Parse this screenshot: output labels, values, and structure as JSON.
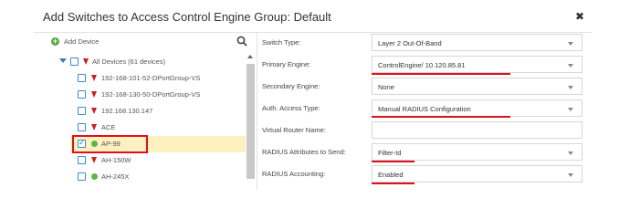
{
  "dialog": {
    "title": "Add Switches to Access Control Engine Group: Default",
    "close_icon": "close-icon"
  },
  "tree": {
    "add_label": "Add Device",
    "root_label": "All Devices (61 devices)",
    "nodes": [
      {
        "label": "192-168-101-52-DPortGroup-VS",
        "status": "down",
        "checked": false
      },
      {
        "label": "192-168-130-50-DPortGroup-VS",
        "status": "down",
        "checked": false
      },
      {
        "label": "192.168.130.147",
        "status": "down",
        "checked": false
      },
      {
        "label": "ACE",
        "status": "down",
        "checked": false
      },
      {
        "label": "AP-99",
        "status": "up",
        "checked": true
      },
      {
        "label": "AH-150W",
        "status": "down",
        "checked": false
      },
      {
        "label": "AH-245X",
        "status": "up",
        "checked": false
      }
    ]
  },
  "form": {
    "fields": [
      {
        "label": "Switch Type:",
        "value": "Layer 2 Out-Of-Band",
        "dropdown": true
      },
      {
        "label": "Primary Engine:",
        "value": "ControlEngine/ 10.120.85.81",
        "dropdown": true
      },
      {
        "label": "Secondary Engine:",
        "value": "None",
        "dropdown": true
      },
      {
        "label": "Auth. Access Type:",
        "value": "Manual RADIUS Configuration",
        "dropdown": true
      },
      {
        "label": "Virtual Router Name:",
        "value": "",
        "dropdown": false
      },
      {
        "label": "RADIUS Attributes to Send:",
        "value": "Filter-Id",
        "dropdown": true
      },
      {
        "label": "RADIUS Accounting:",
        "value": "Enabled",
        "dropdown": true
      }
    ]
  },
  "colors": {
    "highlight": "#e0101a",
    "selected_row": "#fdf1c2",
    "status_up": "#5cb545",
    "status_down": "#c8202a"
  }
}
